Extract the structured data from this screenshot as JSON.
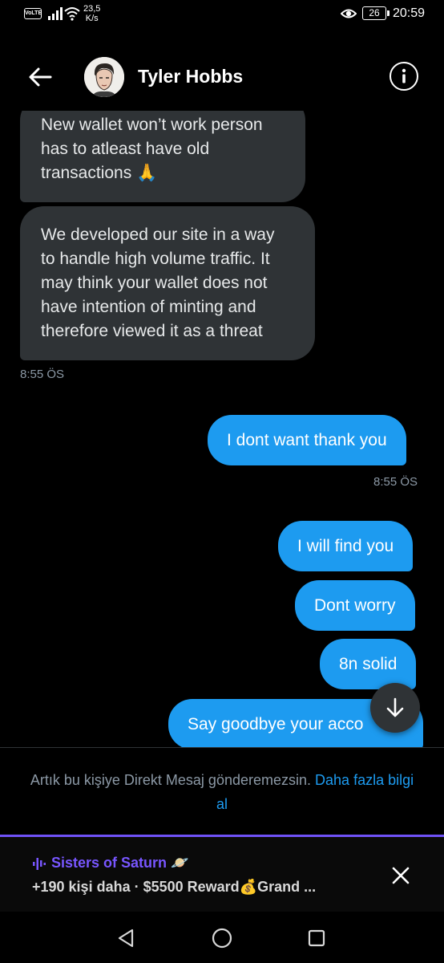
{
  "status_bar": {
    "volte": "VoLTE",
    "speed_value": "23,5",
    "speed_unit": "K/s",
    "battery": "26",
    "time": "20:59"
  },
  "header": {
    "name": "Tyler Hobbs",
    "back_icon": "arrow-left-icon",
    "info_icon": "info-icon"
  },
  "messages": [
    {
      "from": "them",
      "lines": [
        "New wallet won’t work person",
        "has to atleast have old",
        "transactions 🙏"
      ]
    },
    {
      "from": "them",
      "lines": [
        "We developed our site in a way",
        "to handle high volume traffic. It",
        "may think your wallet does not",
        "have intention of minting and",
        "therefore viewed it as a threat"
      ]
    },
    {
      "timestamp": "8:55 ÖS"
    },
    {
      "from": "me",
      "text": "I dont want thank you"
    },
    {
      "timestamp": "8:55 ÖS"
    },
    {
      "from": "me",
      "text": "I will find you"
    },
    {
      "from": "me",
      "text": "Dont worry"
    },
    {
      "from": "me",
      "text": "8n solid"
    },
    {
      "from": "me",
      "text": "Say goodbye your acco"
    }
  ],
  "notice": {
    "text": "Artık bu kişiye Direkt Mesaj gönderemezsin.",
    "link": "Daha fazla bilgi al"
  },
  "spaces": {
    "title": "Sisters of Saturn 🪐",
    "subtitle": "+190 kişi daha · $5500 Reward💰Grand ...",
    "accent": "#7856ff"
  },
  "colors": {
    "background": "#000000",
    "incoming_bubble": "#2f3336",
    "outgoing_bubble": "#1d9bf0",
    "muted_text": "#8b98a5"
  }
}
